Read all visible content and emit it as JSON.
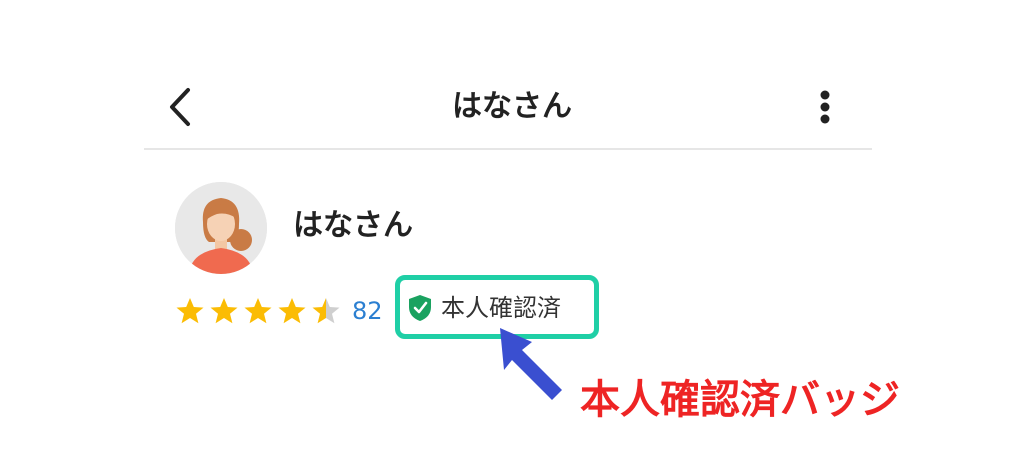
{
  "header": {
    "title": "はなさん",
    "back_icon": "chevron-left-icon",
    "more_icon": "vertical-dots-icon"
  },
  "profile": {
    "name": "はなさん",
    "avatar": "woman-avatar",
    "rating": 4.5,
    "rating_max": 5,
    "review_count": "82",
    "star_color": "#fbbc04",
    "verified_badge": {
      "label": "本人確認済",
      "icon": "shield-check-icon",
      "icon_color": "#1aa260"
    }
  },
  "annotation": {
    "label": "本人確認済バッジ",
    "label_color": "#ee2424",
    "arrow_color": "#3a4fd0",
    "highlight_color": "#1fcfa6"
  }
}
